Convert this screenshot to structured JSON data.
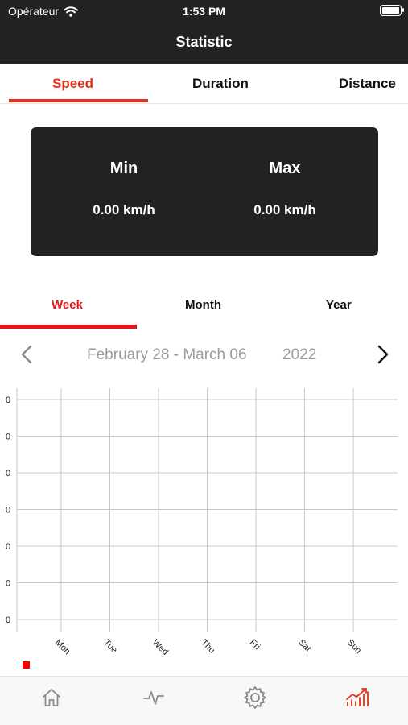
{
  "status_bar": {
    "carrier": "Opérateur",
    "time": "1:53 PM",
    "wifi_icon": "wifi-icon",
    "battery_icon": "battery-icon"
  },
  "nav": {
    "title": "Statistic"
  },
  "metric_tabs": {
    "items": [
      "Speed",
      "Duration",
      "Distance"
    ],
    "selected": "Speed"
  },
  "summary": {
    "min_label": "Min",
    "min_value": "0.00 km/h",
    "max_label": "Max",
    "max_value": "0.00 km/h"
  },
  "period_tabs": {
    "items": [
      "Week",
      "Month",
      "Year"
    ],
    "selected": "Week"
  },
  "date_nav": {
    "range": "February 28 - March 06",
    "year": "2022",
    "prev_icon": "chevron-left-icon",
    "next_icon": "chevron-right-icon"
  },
  "colors": {
    "dark": "#232122",
    "accent": "#e4321b",
    "legend": "#ff0000",
    "muted": "#9b9b9b",
    "grid": "#c8c8c8"
  },
  "chart_data": {
    "type": "line",
    "categories": [
      "Mon",
      "Tue",
      "Wed",
      "Thu",
      "Fri",
      "Sat",
      "Sun"
    ],
    "series": [
      {
        "values": [
          0,
          0,
          0,
          0,
          0,
          0,
          0
        ]
      }
    ],
    "y_tick_labels": [
      "0",
      "0",
      "0",
      "0",
      "0",
      "0",
      "0"
    ],
    "grid": true,
    "legend_placement": "bottom-left"
  },
  "tab_bar": {
    "items": [
      "home-icon",
      "activity-icon",
      "settings-icon",
      "statistics-icon"
    ],
    "selected": "statistics-icon"
  }
}
